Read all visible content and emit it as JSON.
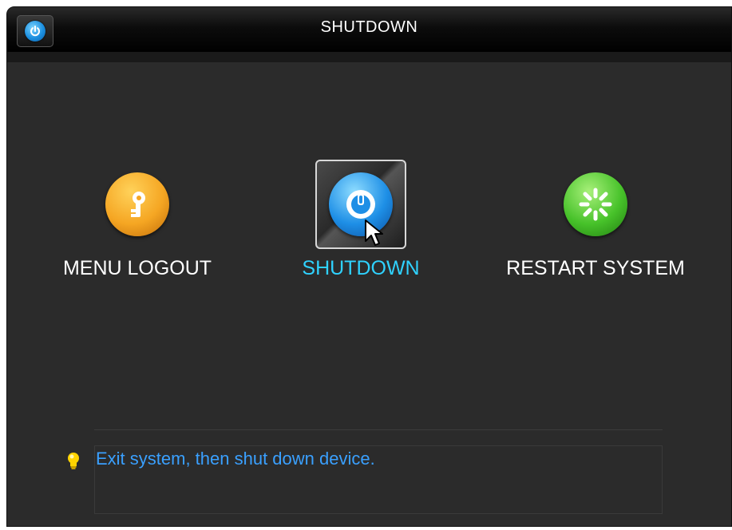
{
  "window": {
    "title": "SHUTDOWN",
    "title_icon": "power-icon"
  },
  "options": [
    {
      "label": "MENU LOGOUT",
      "icon": "key-icon",
      "color": "#f5a623",
      "selected": false
    },
    {
      "label": "SHUTDOWN",
      "icon": "power-icon",
      "color": "#1e8fe6",
      "selected": true
    },
    {
      "label": "RESTART SYSTEM",
      "icon": "restart-spinner-icon",
      "color": "#47c22a",
      "selected": false
    }
  ],
  "hint": {
    "icon": "lightbulb-icon",
    "text": "Exit system, then shut down device."
  },
  "colors": {
    "selected_label": "#2fd2ff",
    "hint_text": "#3aa0ff"
  }
}
